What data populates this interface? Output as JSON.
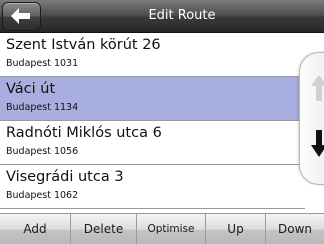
{
  "header": {
    "title": "Edit Route",
    "back_icon": "arrow-left-icon"
  },
  "route": {
    "stops": [
      {
        "name": "Szent István körút 26",
        "city": "Budapest 1031",
        "selected": false
      },
      {
        "name": "Váci út",
        "city": "Budapest 1134",
        "selected": true
      },
      {
        "name": "Radnóti Miklós utca 6",
        "city": "Budapest 1056",
        "selected": false
      },
      {
        "name": "Visegrádi utca 3",
        "city": "Budapest 1062",
        "selected": false
      }
    ]
  },
  "scroll": {
    "up_icon": "arrow-up-icon",
    "up_enabled": false,
    "down_icon": "arrow-down-icon",
    "down_enabled": true
  },
  "toolbar": {
    "add_label": "Add",
    "delete_label": "Delete",
    "optimise_label": "Optimise",
    "up_label": "Up",
    "down_label": "Down"
  },
  "colors": {
    "selected_row": "#a9aee0",
    "header": "#3a3a3a"
  }
}
